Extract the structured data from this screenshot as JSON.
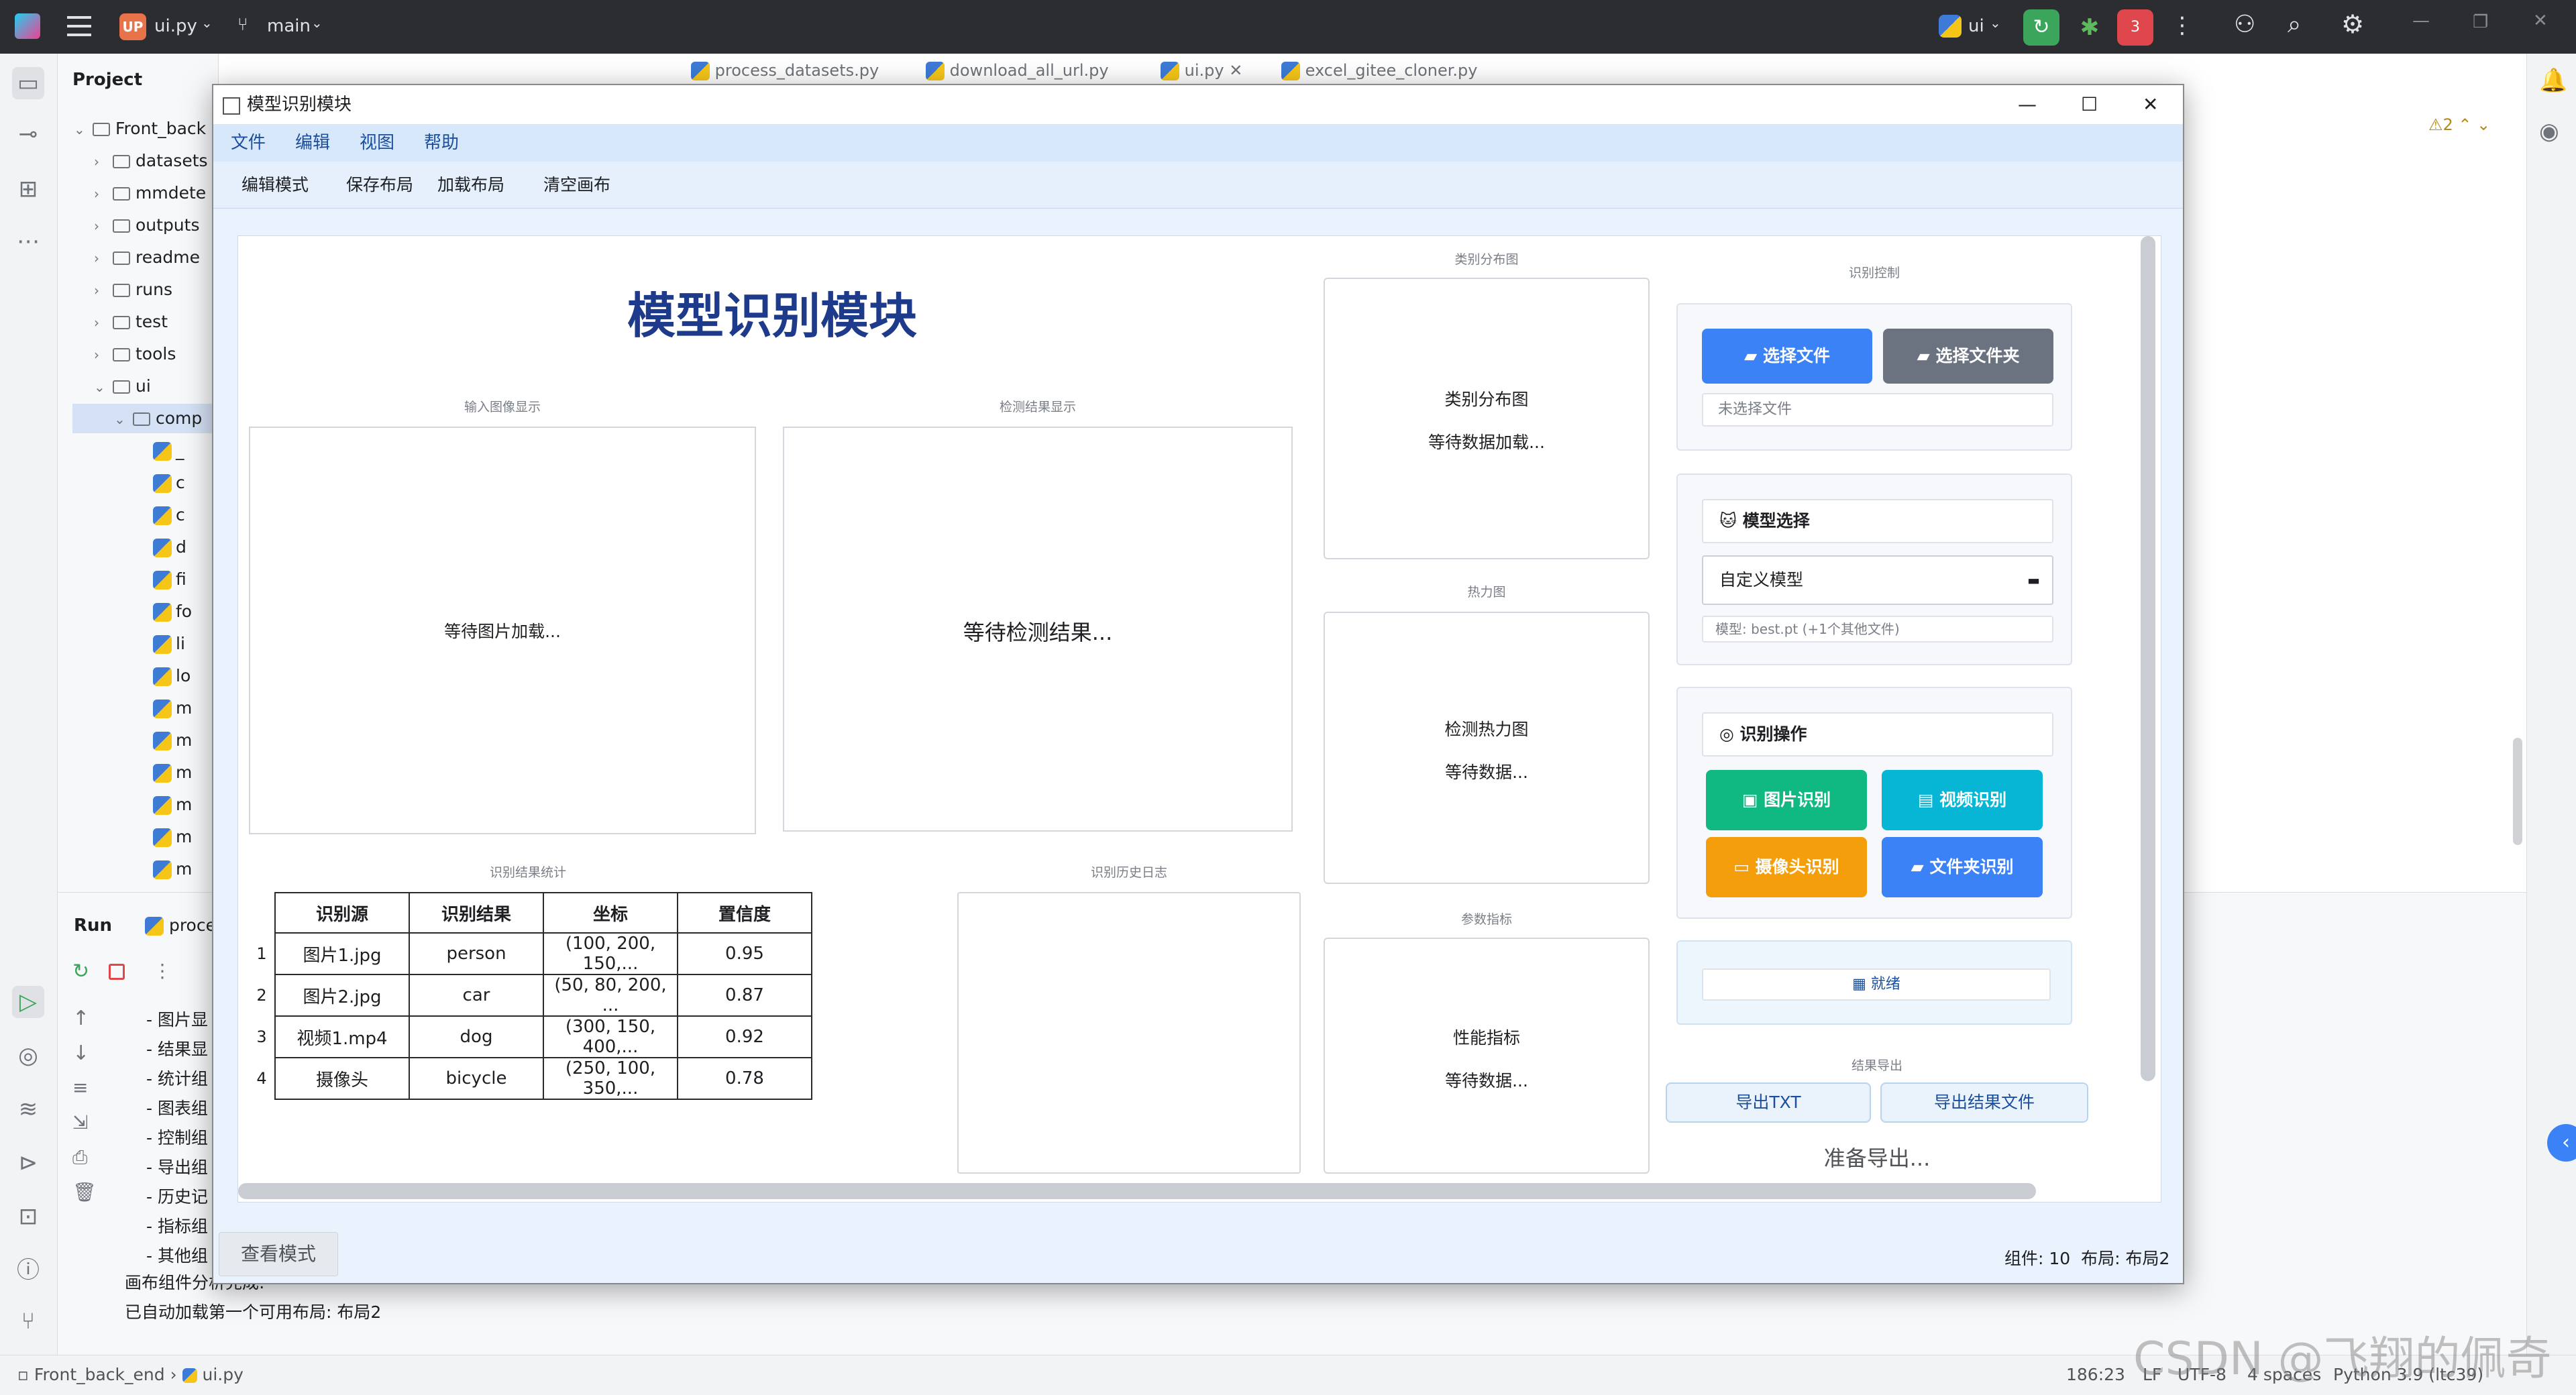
{
  "ide": {
    "project_badge": "UP",
    "file_name": "ui.py",
    "branch": "main",
    "run_config": "ui",
    "notif_count": "3",
    "project_label": "Project",
    "tree": [
      {
        "label": "Front_back",
        "type": "folder",
        "level": 0,
        "open": true
      },
      {
        "label": "datasets",
        "type": "folder",
        "level": 1
      },
      {
        "label": "mmdete",
        "type": "folder",
        "level": 1
      },
      {
        "label": "outputs",
        "type": "folder",
        "level": 1
      },
      {
        "label": "readme",
        "type": "folder",
        "level": 1
      },
      {
        "label": "runs",
        "type": "folder",
        "level": 1
      },
      {
        "label": "test",
        "type": "folder",
        "level": 1
      },
      {
        "label": "tools",
        "type": "folder",
        "level": 1
      },
      {
        "label": "ui",
        "type": "folder",
        "level": 1,
        "open": true
      },
      {
        "label": "comp",
        "type": "folder",
        "level": 2,
        "open": true,
        "selected": true
      },
      {
        "label": "_",
        "type": "py",
        "level": 3
      },
      {
        "label": "c",
        "type": "py",
        "level": 3
      },
      {
        "label": "c",
        "type": "py",
        "level": 3
      },
      {
        "label": "d",
        "type": "py",
        "level": 3
      },
      {
        "label": "fi",
        "type": "py",
        "level": 3
      },
      {
        "label": "fo",
        "type": "py",
        "level": 3
      },
      {
        "label": "li",
        "type": "py",
        "level": 3
      },
      {
        "label": "lo",
        "type": "py",
        "level": 3
      },
      {
        "label": "m",
        "type": "py",
        "level": 3
      },
      {
        "label": "m",
        "type": "py",
        "level": 3
      },
      {
        "label": "m",
        "type": "py",
        "level": 3
      },
      {
        "label": "m",
        "type": "py",
        "level": 3
      },
      {
        "label": "m",
        "type": "py",
        "level": 3
      },
      {
        "label": "m",
        "type": "py",
        "level": 3
      }
    ],
    "editor_tabs": [
      "process_datasets.py",
      "download_all_url.py",
      "ui.py",
      "excel_gitee_cloner.py"
    ],
    "warnings": "2",
    "run_label": "Run",
    "run_tab": "proce",
    "run_lines": [
      "- 图片显",
      "- 结果显",
      "- 统计组",
      "- 图表组",
      "- 控制组",
      "- 导出组",
      "- 历史记",
      "- 指标组",
      "- 其他组"
    ],
    "run_tail1": "画布组件分析完成:",
    "run_tail2": "已自动加载第一个可用布局: 布局2",
    "breadcrumb_root": "Front_back_end",
    "breadcrumb_file": "ui.py",
    "status": {
      "position": "186:23",
      "eol": "LF",
      "encoding": "UTF-8",
      "indent": "4 spaces",
      "interpreter": "Python 3.9 (ltc39)"
    }
  },
  "app": {
    "title": "模型识别模块",
    "menu": [
      "文件",
      "编辑",
      "视图",
      "帮助"
    ],
    "toolbar": [
      "编辑模式",
      "保存布局",
      "加载布局",
      "清空画布"
    ],
    "heading": "模型识别模块",
    "input_group": {
      "title": "输入图像显示",
      "placeholder": "等待图片加载..."
    },
    "result_group": {
      "title": "检测结果显示",
      "placeholder": "等待检测结果..."
    },
    "category_group": {
      "title": "类别分布图",
      "line1": "类别分布图",
      "line2": "等待数据加载..."
    },
    "heatmap_group": {
      "title": "热力图",
      "line1": "检测热力图",
      "line2": "等待数据..."
    },
    "metrics_group": {
      "title": "参数指标",
      "line1": "性能指标",
      "line2": "等待数据..."
    },
    "stats_group": {
      "title": "识别结果统计",
      "headers": [
        "识别源",
        "识别结果",
        "坐标",
        "置信度"
      ],
      "rows": [
        {
          "idx": "1",
          "source": "图片1.jpg",
          "result": "person",
          "coord": "(100, 200, 150,...",
          "conf": "0.95"
        },
        {
          "idx": "2",
          "source": "图片2.jpg",
          "result": "car",
          "coord": "(50, 80, 200, ...",
          "conf": "0.87"
        },
        {
          "idx": "3",
          "source": "视频1.mp4",
          "result": "dog",
          "coord": "(300, 150, 400,...",
          "conf": "0.92"
        },
        {
          "idx": "4",
          "source": "摄像头",
          "result": "bicycle",
          "coord": "(250, 100, 350,...",
          "conf": "0.78"
        }
      ]
    },
    "history_group": {
      "title": "识别历史日志"
    },
    "control_group": {
      "title": "识别控制",
      "select_file": "选择文件",
      "select_folder": "选择文件夹",
      "no_file": "未选择文件",
      "model_header": "模型选择",
      "model_value": "自定义模型",
      "model_info": "模型: best.pt (+1个其他文件)",
      "ops_header": "识别操作",
      "image_btn": "图片识别",
      "video_btn": "视频识别",
      "camera_btn": "摄像头识别",
      "folder_btn": "文件夹识别",
      "status": "就绪"
    },
    "export_group": {
      "title": "结果导出",
      "txt_btn": "导出TXT",
      "file_btn": "导出结果文件",
      "status": "准备导出..."
    },
    "view_mode_btn": "查看模式",
    "footer_info": "组件: 10  布局: 布局2",
    "colors": {
      "blue": "#3b82f6",
      "gray": "#6b7280",
      "green": "#10b981",
      "cyan": "#06b6d4",
      "amber": "#f59e0b",
      "title_blue": "#1e3a8a"
    }
  },
  "watermark": "CSDN @飞翔的佩奇"
}
